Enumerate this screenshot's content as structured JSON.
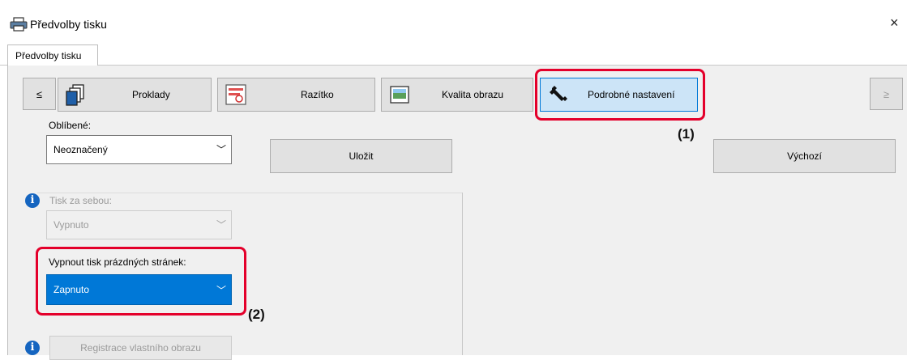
{
  "window": {
    "title": "Předvolby tisku",
    "close_glyph": "×"
  },
  "tabs": [
    {
      "label": "Předvolby tisku"
    }
  ],
  "nav": {
    "prev": "≤",
    "next": "≥"
  },
  "categories": [
    {
      "label": "Proklady",
      "icon": "pages-stack-icon"
    },
    {
      "label": "Razítko",
      "icon": "stamp-icon"
    },
    {
      "label": "Kvalita obrazu",
      "icon": "image-quality-icon"
    },
    {
      "label": "Podrobné nastavení",
      "icon": "wrench-icon",
      "selected": true
    }
  ],
  "favorites": {
    "label": "Oblíbené:",
    "value": "Neoznačený",
    "save_label": "Uložit",
    "default_label": "Výchozí"
  },
  "tandem": {
    "label": "Tisk za sebou:",
    "value": "Vypnuto"
  },
  "blank_pages": {
    "label": "Vypnout tisk prázdných stránek:",
    "value": "Zapnuto"
  },
  "register_image": {
    "label": "Registrace vlastního obrazu"
  },
  "callouts": {
    "one": "(1)",
    "two": "(2)"
  },
  "colors": {
    "highlight_red": "#e4002b",
    "selected_blue": "#0078d7",
    "info_blue": "#1565c0"
  }
}
